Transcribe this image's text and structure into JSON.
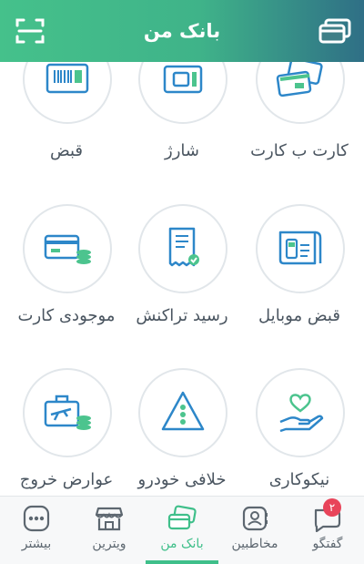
{
  "header": {
    "title": "بانک من"
  },
  "services": [
    {
      "label": "کارت ب کارت",
      "icon": "card-to-card-icon"
    },
    {
      "label": "شارژ",
      "icon": "sim-card-icon"
    },
    {
      "label": "قبض",
      "icon": "bill-barcode-icon"
    },
    {
      "label": "قبض موبایل",
      "icon": "mobile-bill-icon"
    },
    {
      "label": "رسید تراکنش",
      "icon": "transaction-receipt-icon"
    },
    {
      "label": "موجودی کارت",
      "icon": "card-balance-icon"
    },
    {
      "label": "نیکوکاری",
      "icon": "charity-heart-icon"
    },
    {
      "label": "خلافی خودرو",
      "icon": "car-violation-warning-icon"
    },
    {
      "label": "عوارض خروج",
      "icon": "exit-toll-luggage-icon"
    }
  ],
  "tabs": [
    {
      "label": "گفتگو",
      "icon": "chat-icon",
      "badge": "۲"
    },
    {
      "label": "مخاطبین",
      "icon": "contacts-icon"
    },
    {
      "label": "بانک من",
      "icon": "bank-cards-icon",
      "active": true
    },
    {
      "label": "ویترین",
      "icon": "storefront-icon"
    },
    {
      "label": "بیشتر",
      "icon": "more-icon"
    }
  ],
  "colors": {
    "accent": "#3fbf8a",
    "icon_blue": "#2d87c9",
    "icon_green": "#4cc48e",
    "badge": "#e8445a"
  }
}
